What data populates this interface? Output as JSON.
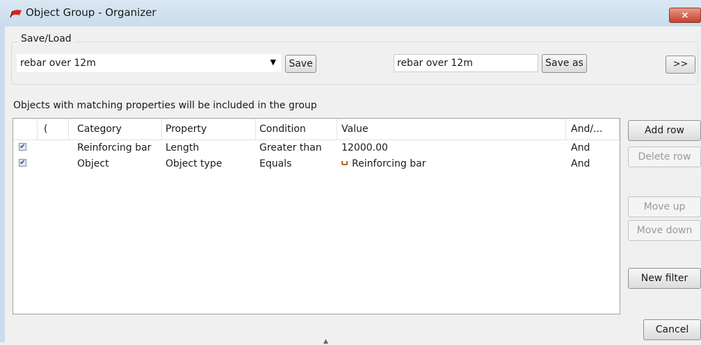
{
  "window": {
    "title": "Object Group - Organizer",
    "close_glyph": "×",
    "app_icon": "red-flag-icon",
    "accent": "#c6412a"
  },
  "save_load": {
    "label": "Save/Load",
    "combo_value": "rebar over 12m",
    "combo_arrow": "▼",
    "save_label": "Save",
    "saveas_value": "rebar over 12m",
    "saveas_label": "Save as",
    "expand_label": ">>"
  },
  "hint": "Objects with matching properties will be included in the group",
  "grid": {
    "columns": [
      "(",
      "Category",
      "Property",
      "Condition",
      "Value",
      "And/..."
    ],
    "rows": [
      {
        "checked": true,
        "paren": "",
        "category": "Reinforcing bar",
        "property": "Length",
        "condition": "Greater than",
        "value": "12000.00",
        "andor": "And",
        "value_icon": ""
      },
      {
        "checked": true,
        "paren": "",
        "category": "Object",
        "property": "Object type",
        "condition": "Equals",
        "value": "Reinforcing bar",
        "andor": "And",
        "value_icon": "rebar-icon"
      }
    ]
  },
  "side_buttons": {
    "add_row": "Add row",
    "delete_row": "Delete row",
    "move_up": "Move up",
    "move_down": "Move down",
    "new_filter": "New filter",
    "cancel": "Cancel"
  }
}
